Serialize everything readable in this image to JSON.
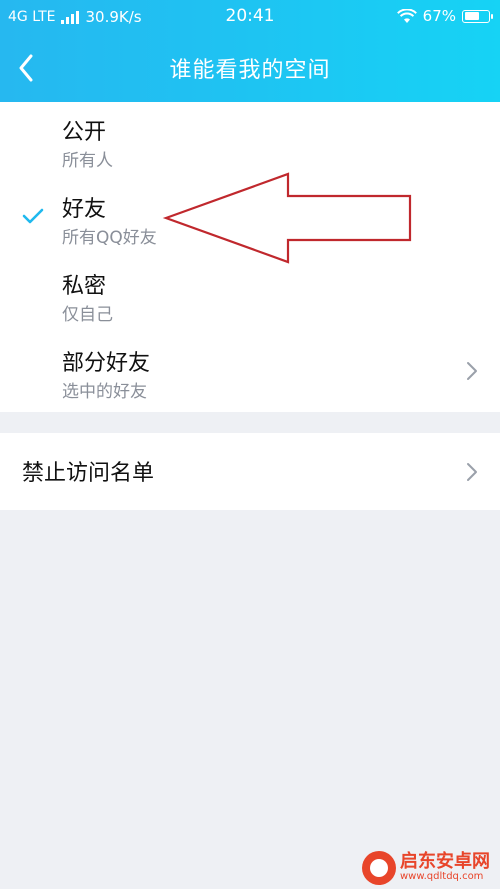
{
  "status_bar": {
    "network": "4G LTE",
    "speed": "30.9K/s",
    "time": "20:41",
    "battery_percent": "67%",
    "battery_level": 0.67
  },
  "nav": {
    "title": "谁能看我的空间"
  },
  "options": [
    {
      "title": "公开",
      "subtitle": "所有人",
      "selected": false
    },
    {
      "title": "好友",
      "subtitle": "所有QQ好友",
      "selected": true
    },
    {
      "title": "私密",
      "subtitle": "仅自己",
      "selected": false
    },
    {
      "title": "部分好友",
      "subtitle": "选中的好友",
      "selected": false
    }
  ],
  "blocked": {
    "title": "禁止访问名单"
  },
  "watermark": {
    "name": "启东安卓网",
    "url": "www.qdltdq.com"
  },
  "colors": {
    "accent": "#1fb9ee",
    "annotation": "#c0282d"
  }
}
